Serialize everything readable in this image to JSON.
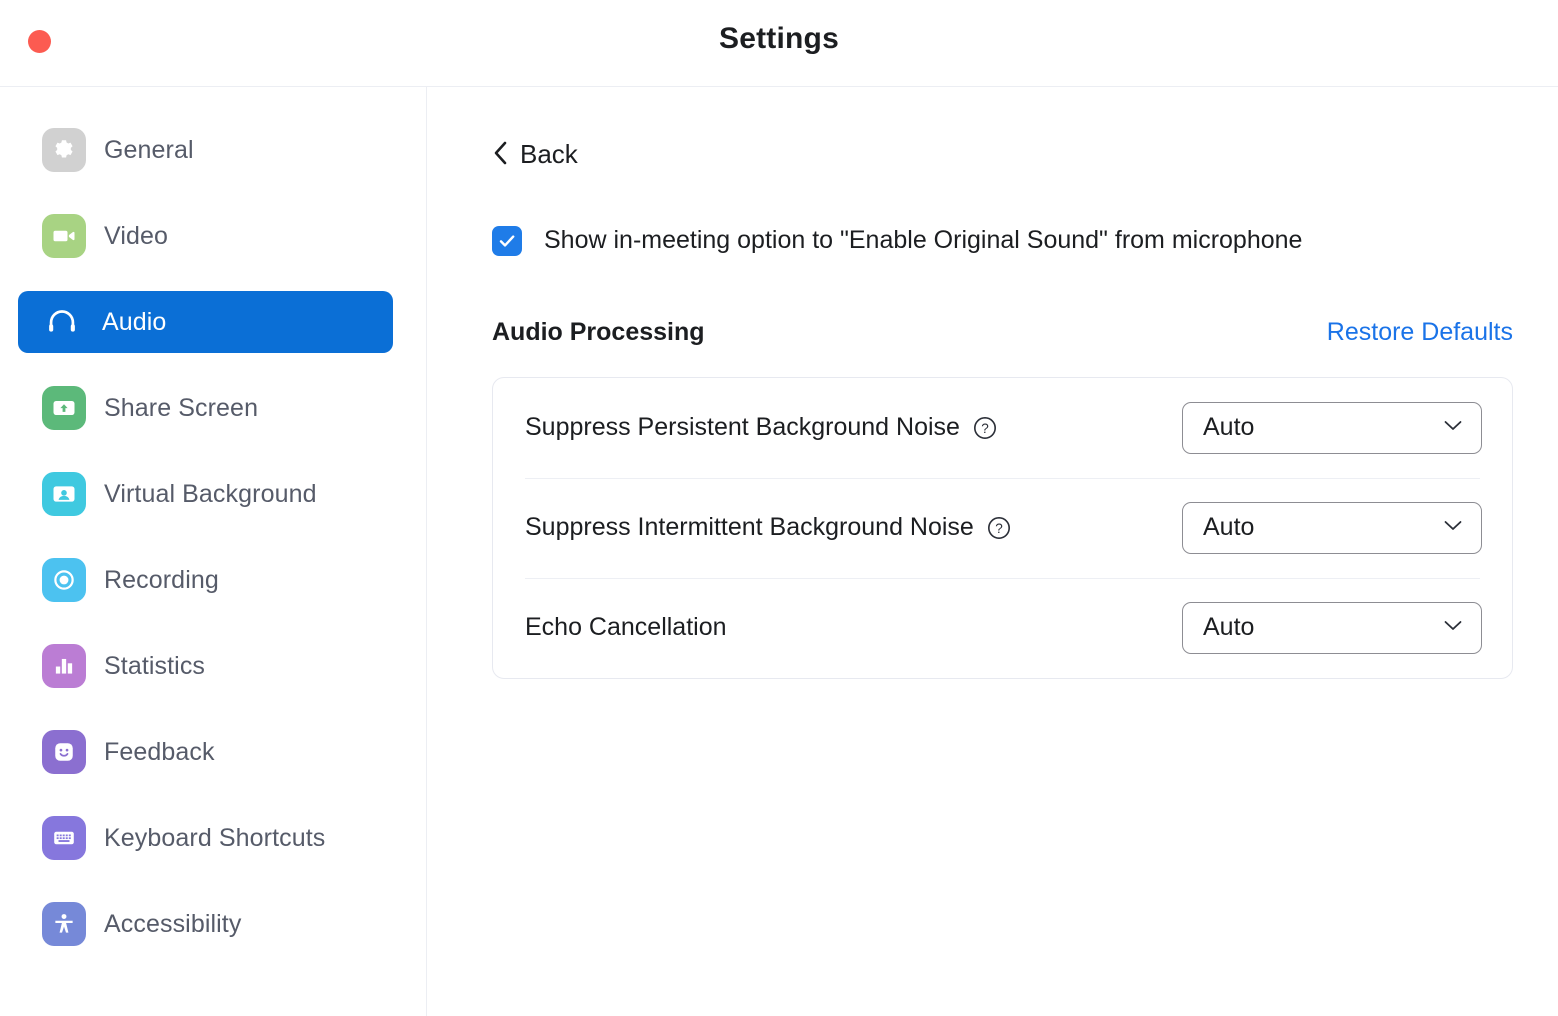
{
  "window": {
    "title": "Settings",
    "close_button": "close",
    "accent_blue": "#0b6fd6",
    "link_blue": "#1a73e8",
    "close_red": "#fc5b51"
  },
  "sidebar": {
    "items": [
      {
        "label": "General",
        "icon": "gear-icon",
        "color": "#d1d1d1",
        "active": false
      },
      {
        "label": "Video",
        "icon": "video-camera-icon",
        "color": "#a8d383",
        "active": false
      },
      {
        "label": "Audio",
        "icon": "headphones-icon",
        "color": "#0b6fd6",
        "active": true
      },
      {
        "label": "Share Screen",
        "icon": "share-screen-icon",
        "color": "#5cb97a",
        "active": false
      },
      {
        "label": "Virtual Background",
        "icon": "virtual-background-icon",
        "color": "#3fc9e0",
        "active": false
      },
      {
        "label": "Recording",
        "icon": "record-circle-icon",
        "color": "#4cc2f0",
        "active": false
      },
      {
        "label": "Statistics",
        "icon": "bar-chart-icon",
        "color": "#bb7dd4",
        "active": false
      },
      {
        "label": "Feedback",
        "icon": "smiley-face-icon",
        "color": "#8b6fd0",
        "active": false
      },
      {
        "label": "Keyboard Shortcuts",
        "icon": "keyboard-icon",
        "color": "#8677dd",
        "active": false
      },
      {
        "label": "Accessibility",
        "icon": "accessibility-icon",
        "color": "#7689d8",
        "active": false
      }
    ]
  },
  "main": {
    "back_label": "Back",
    "original_sound": {
      "label": "Show in-meeting option to \"Enable Original Sound\" from microphone",
      "checked": true
    },
    "audio_processing": {
      "title": "Audio Processing",
      "restore_label": "Restore Defaults",
      "rows": [
        {
          "label": "Suppress Persistent Background Noise",
          "help": true,
          "value": "Auto"
        },
        {
          "label": "Suppress Intermittent Background Noise",
          "help": true,
          "value": "Auto"
        },
        {
          "label": "Echo Cancellation",
          "help": false,
          "value": "Auto"
        }
      ]
    }
  }
}
